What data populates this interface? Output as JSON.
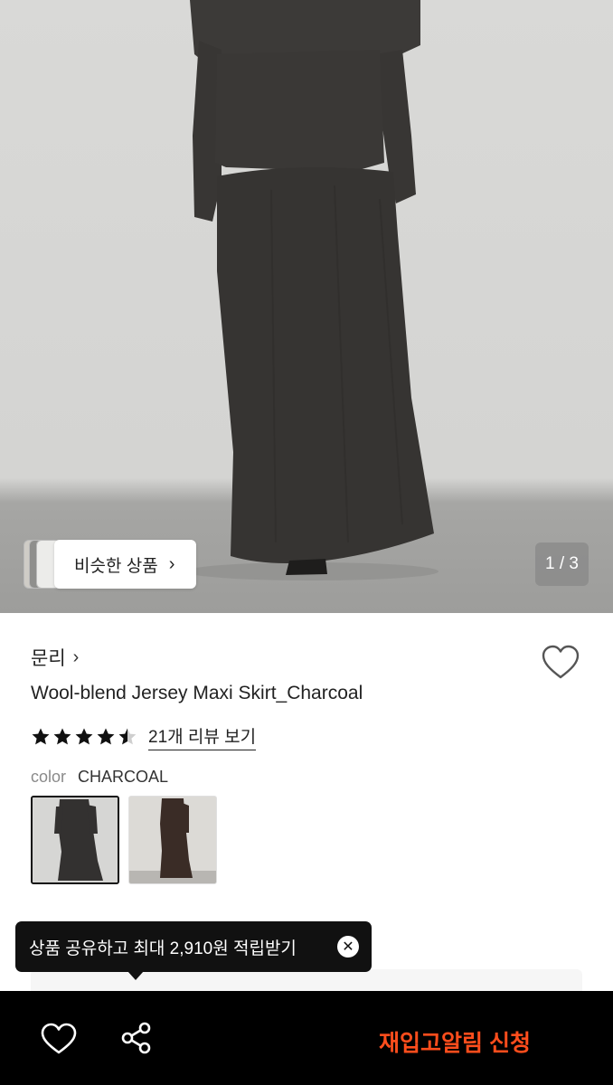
{
  "gallery": {
    "similar_label": "비슷한 상품",
    "similar_chevron": "›",
    "counter": "1 / 3"
  },
  "product": {
    "brand": "문리",
    "brand_chevron": "›",
    "title": "Wool-blend Jersey Maxi Skirt_Charcoal",
    "rating": 4.5,
    "review_link": "21개 리뷰 보기",
    "color_label": "color",
    "color_value": "CHARCOAL",
    "swatches": [
      "charcoal",
      "brown"
    ]
  },
  "tooltip": {
    "text": "상품 공유하고 최대 2,910원 적립받기",
    "close": "✕"
  },
  "bottom_bar": {
    "like_icon": "heart-outline-icon",
    "share_icon": "share-icon",
    "cta": "재입고알림 신청"
  },
  "colors": {
    "cta": "#ff4d1c",
    "bar_bg": "#000000",
    "tooltip_bg": "#111111",
    "garment": "#3a3836"
  }
}
